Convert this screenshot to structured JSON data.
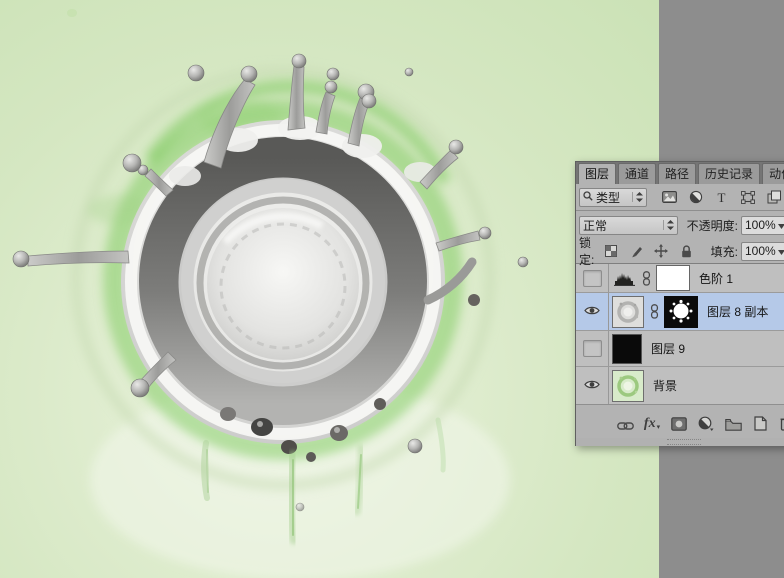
{
  "window": {
    "description": "Photoshop workspace showing a grayscale water-splash crown on a light green canvas with the Layers panel open",
    "workspace_color": "#8d8d8d",
    "canvas_color": "#d9e9c8"
  },
  "canvas": {
    "artwork": "water-splash-crown-desaturated-on-green"
  },
  "panel": {
    "tabs": [
      {
        "label": "图层",
        "active": true
      },
      {
        "label": "通道",
        "active": false
      },
      {
        "label": "路径",
        "active": false
      },
      {
        "label": "历史记录",
        "active": false
      },
      {
        "label": "动作",
        "active": false
      }
    ],
    "filter": {
      "search_type_label": "类型"
    },
    "blend": {
      "mode": "正常",
      "opacity_label": "不透明度:",
      "opacity_value": "100%"
    },
    "lock": {
      "lock_label": "锁定:",
      "fill_label": "填充:",
      "fill_value": "100%"
    },
    "layers": [
      {
        "name": "色阶 1",
        "visible": false,
        "kind": "levels-adjustment",
        "mask": "white"
      },
      {
        "name": "图层 8 副本",
        "visible": true,
        "selected": true,
        "kind": "pixel-splash",
        "mask": "black-with-white-splash"
      },
      {
        "name": "图层 9",
        "visible": false,
        "kind": "pixel-solid-black"
      },
      {
        "name": "背景",
        "visible": true,
        "kind": "background-green-splash"
      }
    ],
    "bottom_icons": [
      "link-layers",
      "layer-style-fx",
      "add-layer-mask",
      "new-adjustment-layer",
      "new-group",
      "new-layer",
      "delete-layer"
    ],
    "fx_label": "fx"
  },
  "colors": {
    "selection_blue": "#b5c9e8",
    "panel_gray": "#b3b3b3",
    "tabbar_gray": "#757575",
    "canvas_green": "#d9e9c8",
    "workspace_gray": "#8d8d8d"
  },
  "icons": {
    "search": "magnifier",
    "filter_kinds": [
      "pixel-layer",
      "adjustment-layer",
      "type-layer",
      "shape-layer",
      "smart-object"
    ],
    "locks": [
      "lock-transparency-checkerboard",
      "lock-pixels-brush",
      "lock-position-move",
      "lock-all-padlock"
    ],
    "layer_link": "chain-8",
    "visibility": "eye"
  }
}
